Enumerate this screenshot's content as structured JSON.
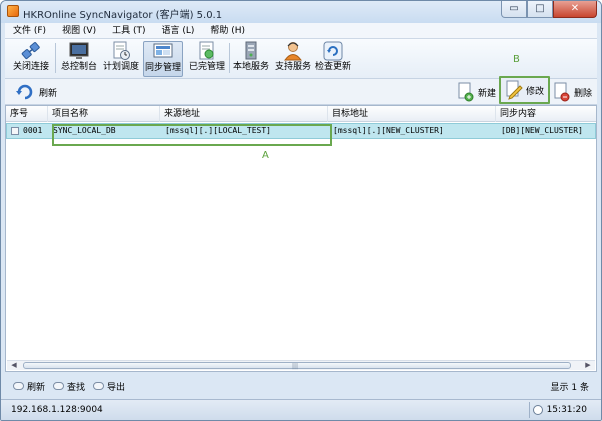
{
  "window": {
    "title": "HKROnline SyncNavigator (客户端) 5.0.1",
    "controls": {
      "minimize": "▭",
      "maximize": "□",
      "close": "✕"
    }
  },
  "menu": [
    "文件 (F)",
    "视图 (V)",
    "工具 (T)",
    "语言 (L)",
    "帮助 (H)"
  ],
  "toolbar": {
    "buttons": [
      {
        "label": "关闭连接",
        "icon": "disconnect-icon"
      },
      {
        "label": "总控制台",
        "icon": "console-icon"
      },
      {
        "label": "计划调度",
        "icon": "schedule-icon"
      },
      {
        "label": "同步管理",
        "icon": "sync-manage-icon",
        "active": true
      },
      {
        "label": "已完管理",
        "icon": "completed-icon"
      },
      {
        "label": "本地服务",
        "icon": "local-service-icon"
      },
      {
        "label": "支持服务",
        "icon": "support-icon"
      },
      {
        "label": "检查更新",
        "icon": "update-icon"
      }
    ]
  },
  "subtoolbar": {
    "refresh": "刷新",
    "new": "新建",
    "edit": "修改",
    "delete": "删除"
  },
  "annotations": {
    "a": "A",
    "b": "B"
  },
  "grid": {
    "columns": [
      "序号",
      "项目名称",
      "来源地址",
      "目标地址",
      "同步内容"
    ],
    "rows": [
      {
        "id": "0001",
        "name": "SYNC_LOCAL_DB",
        "source": "[mssql][.][LOCAL_TEST]",
        "target": "[mssql][.][NEW_CLUSTER]",
        "content": "[DB][NEW_CLUSTER]"
      }
    ],
    "scroll_grip": "|||"
  },
  "bottom": {
    "refresh": "刷新",
    "find": "查找",
    "export": "导出",
    "count": "显示 1 条"
  },
  "status": {
    "address": "192.168.1.128:9004",
    "time": "15:31:20"
  },
  "colors": {
    "selection": "#bfe6ef",
    "highlight_green": "#6aa84f",
    "title_bar": "#c9dcf1"
  }
}
